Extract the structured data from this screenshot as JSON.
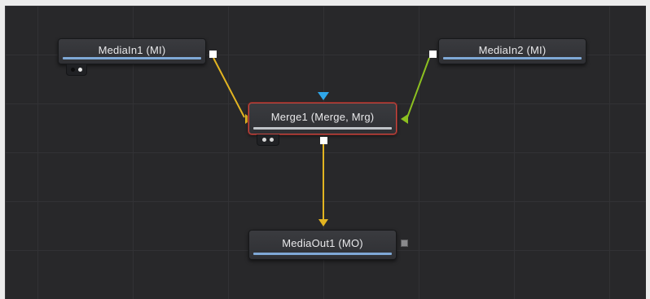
{
  "nodes": {
    "mediain1": {
      "label": "MediaIn1  (MI)"
    },
    "mediain2": {
      "label": "MediaIn2  (MI)"
    },
    "merge1": {
      "label": "Merge1  (Merge, Mrg)"
    },
    "mediaout1": {
      "label": "MediaOut1  (MO)"
    }
  },
  "colors": {
    "canvas": "#28282a",
    "wire_yellow": "#e2b421",
    "wire_green": "#8cc020",
    "input_blue": "#2fa7ea",
    "selection_red": "#c8473f",
    "node_bar_blue": "#7fa8d6"
  },
  "icons": {
    "mask_input": "triangle-down-icon",
    "output_port": "square-port-icon",
    "view_toggle": "two-dots-icon"
  }
}
